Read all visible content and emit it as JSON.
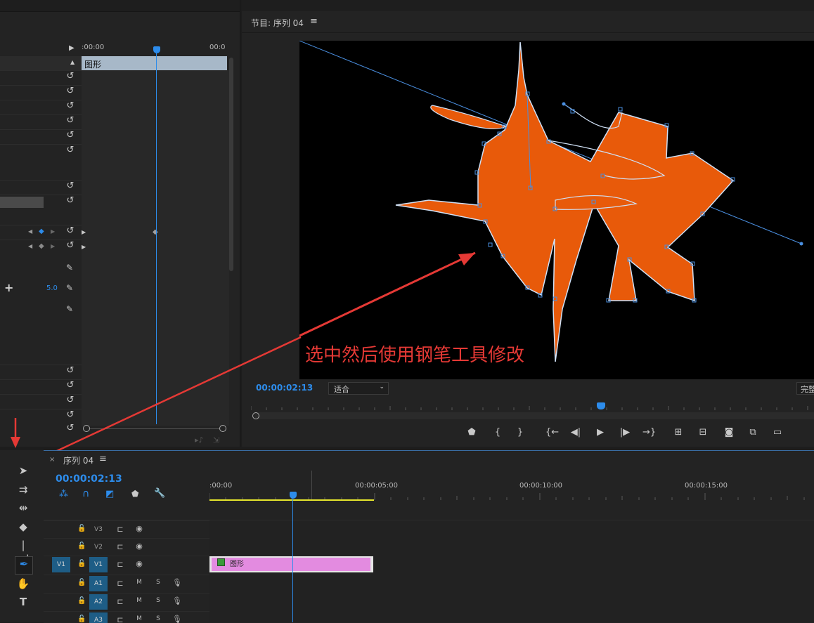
{
  "effect_controls": {
    "ruler_start": ":00:00",
    "ruler_end": "00:0",
    "clip_name": "图形",
    "value_5": "5.0"
  },
  "program_monitor": {
    "tab_title": "节目: 序列 04",
    "menu_icon": "hamburger-icon",
    "timecode": "00:00:02:13",
    "fit_select": "适合",
    "quality": "完整",
    "annotation": "选中然后使用钢笔工具修改",
    "colors": {
      "shape": "#e85a0a",
      "path": "#4a8fe0",
      "annotation": "#e53935"
    }
  },
  "timeline": {
    "tab_title": "序列 04",
    "timecode": "00:00:02:13",
    "ruler": [
      ":00:00",
      "00:00:05:00",
      "00:00:10:00",
      "00:00:15:00"
    ],
    "tracks": {
      "v3": "V3",
      "v2": "V2",
      "v1": "V1",
      "v1_src": "V1",
      "a1": "A1",
      "a2": "A2",
      "a3": "A3",
      "m": "M",
      "s": "S"
    },
    "clip": "图形",
    "colors": {
      "clip": "#e38be0",
      "playhead": "#2d8ceb",
      "work_area": "#e6e62d"
    }
  }
}
